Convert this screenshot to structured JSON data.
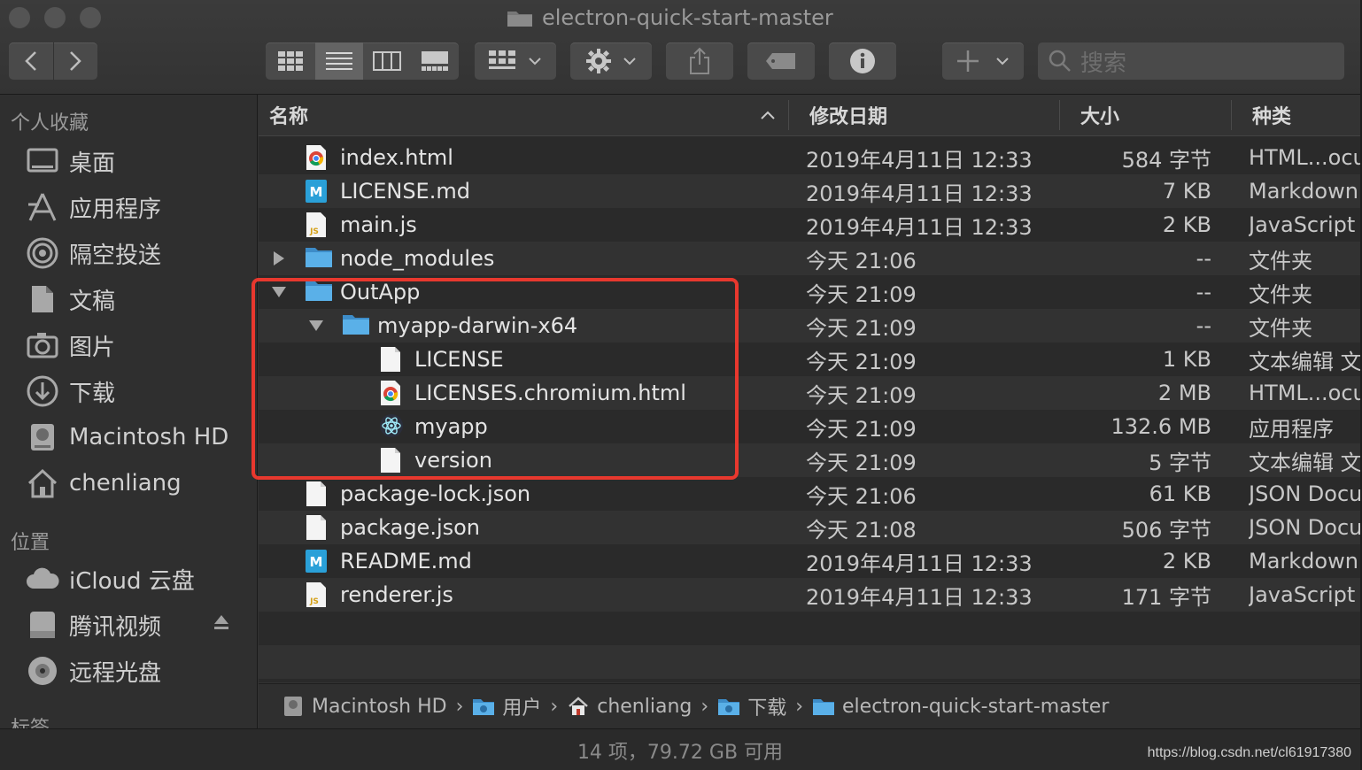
{
  "window": {
    "title": "electron-quick-start-master"
  },
  "toolbar": {
    "search_placeholder": "搜索"
  },
  "sidebar": {
    "sections": [
      {
        "heading": "个人收藏"
      },
      {
        "heading": "位置"
      },
      {
        "heading": "标签"
      }
    ],
    "favorites": [
      {
        "label": "桌面",
        "icon": "desktop-icon"
      },
      {
        "label": "应用程序",
        "icon": "applications-icon"
      },
      {
        "label": "隔空投送",
        "icon": "airdrop-icon"
      },
      {
        "label": "文稿",
        "icon": "documents-icon"
      },
      {
        "label": "图片",
        "icon": "pictures-icon"
      },
      {
        "label": "下载",
        "icon": "downloads-icon"
      },
      {
        "label": "Macintosh HD",
        "icon": "hard-drive-icon"
      },
      {
        "label": "chenliang",
        "icon": "home-icon"
      }
    ],
    "locations": [
      {
        "label": "iCloud 云盘",
        "icon": "icloud-icon"
      },
      {
        "label": "腾讯视频",
        "icon": "disk-icon"
      },
      {
        "label": "远程光盘",
        "icon": "optical-disc-icon"
      }
    ]
  },
  "columns": {
    "name": "名称",
    "date": "修改日期",
    "size": "大小",
    "kind": "种类"
  },
  "rows": [
    {
      "name": "index.html",
      "date": "2019年4月11日 12:33",
      "size": "584 字节",
      "kind": "HTML...ocu",
      "icon": "chrome-html-icon",
      "depth": 0
    },
    {
      "name": "LICENSE.md",
      "date": "2019年4月11日 12:33",
      "size": "7 KB",
      "kind": "Markdown",
      "icon": "markdown-icon",
      "depth": 0
    },
    {
      "name": "main.js",
      "date": "2019年4月11日 12:33",
      "size": "2 KB",
      "kind": "JavaScript",
      "icon": "js-file-icon",
      "depth": 0
    },
    {
      "name": "node_modules",
      "date": "今天 21:06",
      "size": "--",
      "kind": "文件夹",
      "icon": "folder-icon",
      "depth": 0,
      "disclosure": "collapsed"
    },
    {
      "name": "OutApp",
      "date": "今天 21:09",
      "size": "--",
      "kind": "文件夹",
      "icon": "folder-icon",
      "depth": 0,
      "disclosure": "expanded"
    },
    {
      "name": "myapp-darwin-x64",
      "date": "今天 21:09",
      "size": "--",
      "kind": "文件夹",
      "icon": "folder-icon",
      "depth": 1,
      "disclosure": "expanded"
    },
    {
      "name": "LICENSE",
      "date": "今天 21:09",
      "size": "1 KB",
      "kind": "文本编辑 文",
      "icon": "document-icon",
      "depth": 2
    },
    {
      "name": "LICENSES.chromium.html",
      "date": "今天 21:09",
      "size": "2 MB",
      "kind": "HTML...ocu",
      "icon": "chrome-html-icon",
      "depth": 2
    },
    {
      "name": "myapp",
      "date": "今天 21:09",
      "size": "132.6 MB",
      "kind": "应用程序",
      "icon": "electron-app-icon",
      "depth": 2
    },
    {
      "name": "version",
      "date": "今天 21:09",
      "size": "5 字节",
      "kind": "文本编辑 文",
      "icon": "document-icon",
      "depth": 2
    },
    {
      "name": "package-lock.json",
      "date": "今天 21:06",
      "size": "61 KB",
      "kind": "JSON Docu",
      "icon": "document-icon",
      "depth": 0
    },
    {
      "name": "package.json",
      "date": "今天 21:08",
      "size": "506 字节",
      "kind": "JSON Docu",
      "icon": "document-icon",
      "depth": 0
    },
    {
      "name": "README.md",
      "date": "2019年4月11日 12:33",
      "size": "2 KB",
      "kind": "Markdown",
      "icon": "markdown-icon",
      "depth": 0
    },
    {
      "name": "renderer.js",
      "date": "2019年4月11日 12:33",
      "size": "171 字节",
      "kind": "JavaScript",
      "icon": "js-file-icon",
      "depth": 0
    }
  ],
  "pathbar": [
    {
      "label": "Macintosh HD",
      "icon": "hard-drive-icon"
    },
    {
      "label": "用户",
      "icon": "users-folder-icon"
    },
    {
      "label": "chenliang",
      "icon": "home-icon"
    },
    {
      "label": "下载",
      "icon": "downloads-folder-icon"
    },
    {
      "label": "electron-quick-start-master",
      "icon": "folder-icon"
    }
  ],
  "status": {
    "text": "14 项，79.72 GB 可用",
    "watermark": "https://blog.csdn.net/cl61917380"
  },
  "colors": {
    "highlight": "#e8382e",
    "folder": "#5ab0e8"
  }
}
